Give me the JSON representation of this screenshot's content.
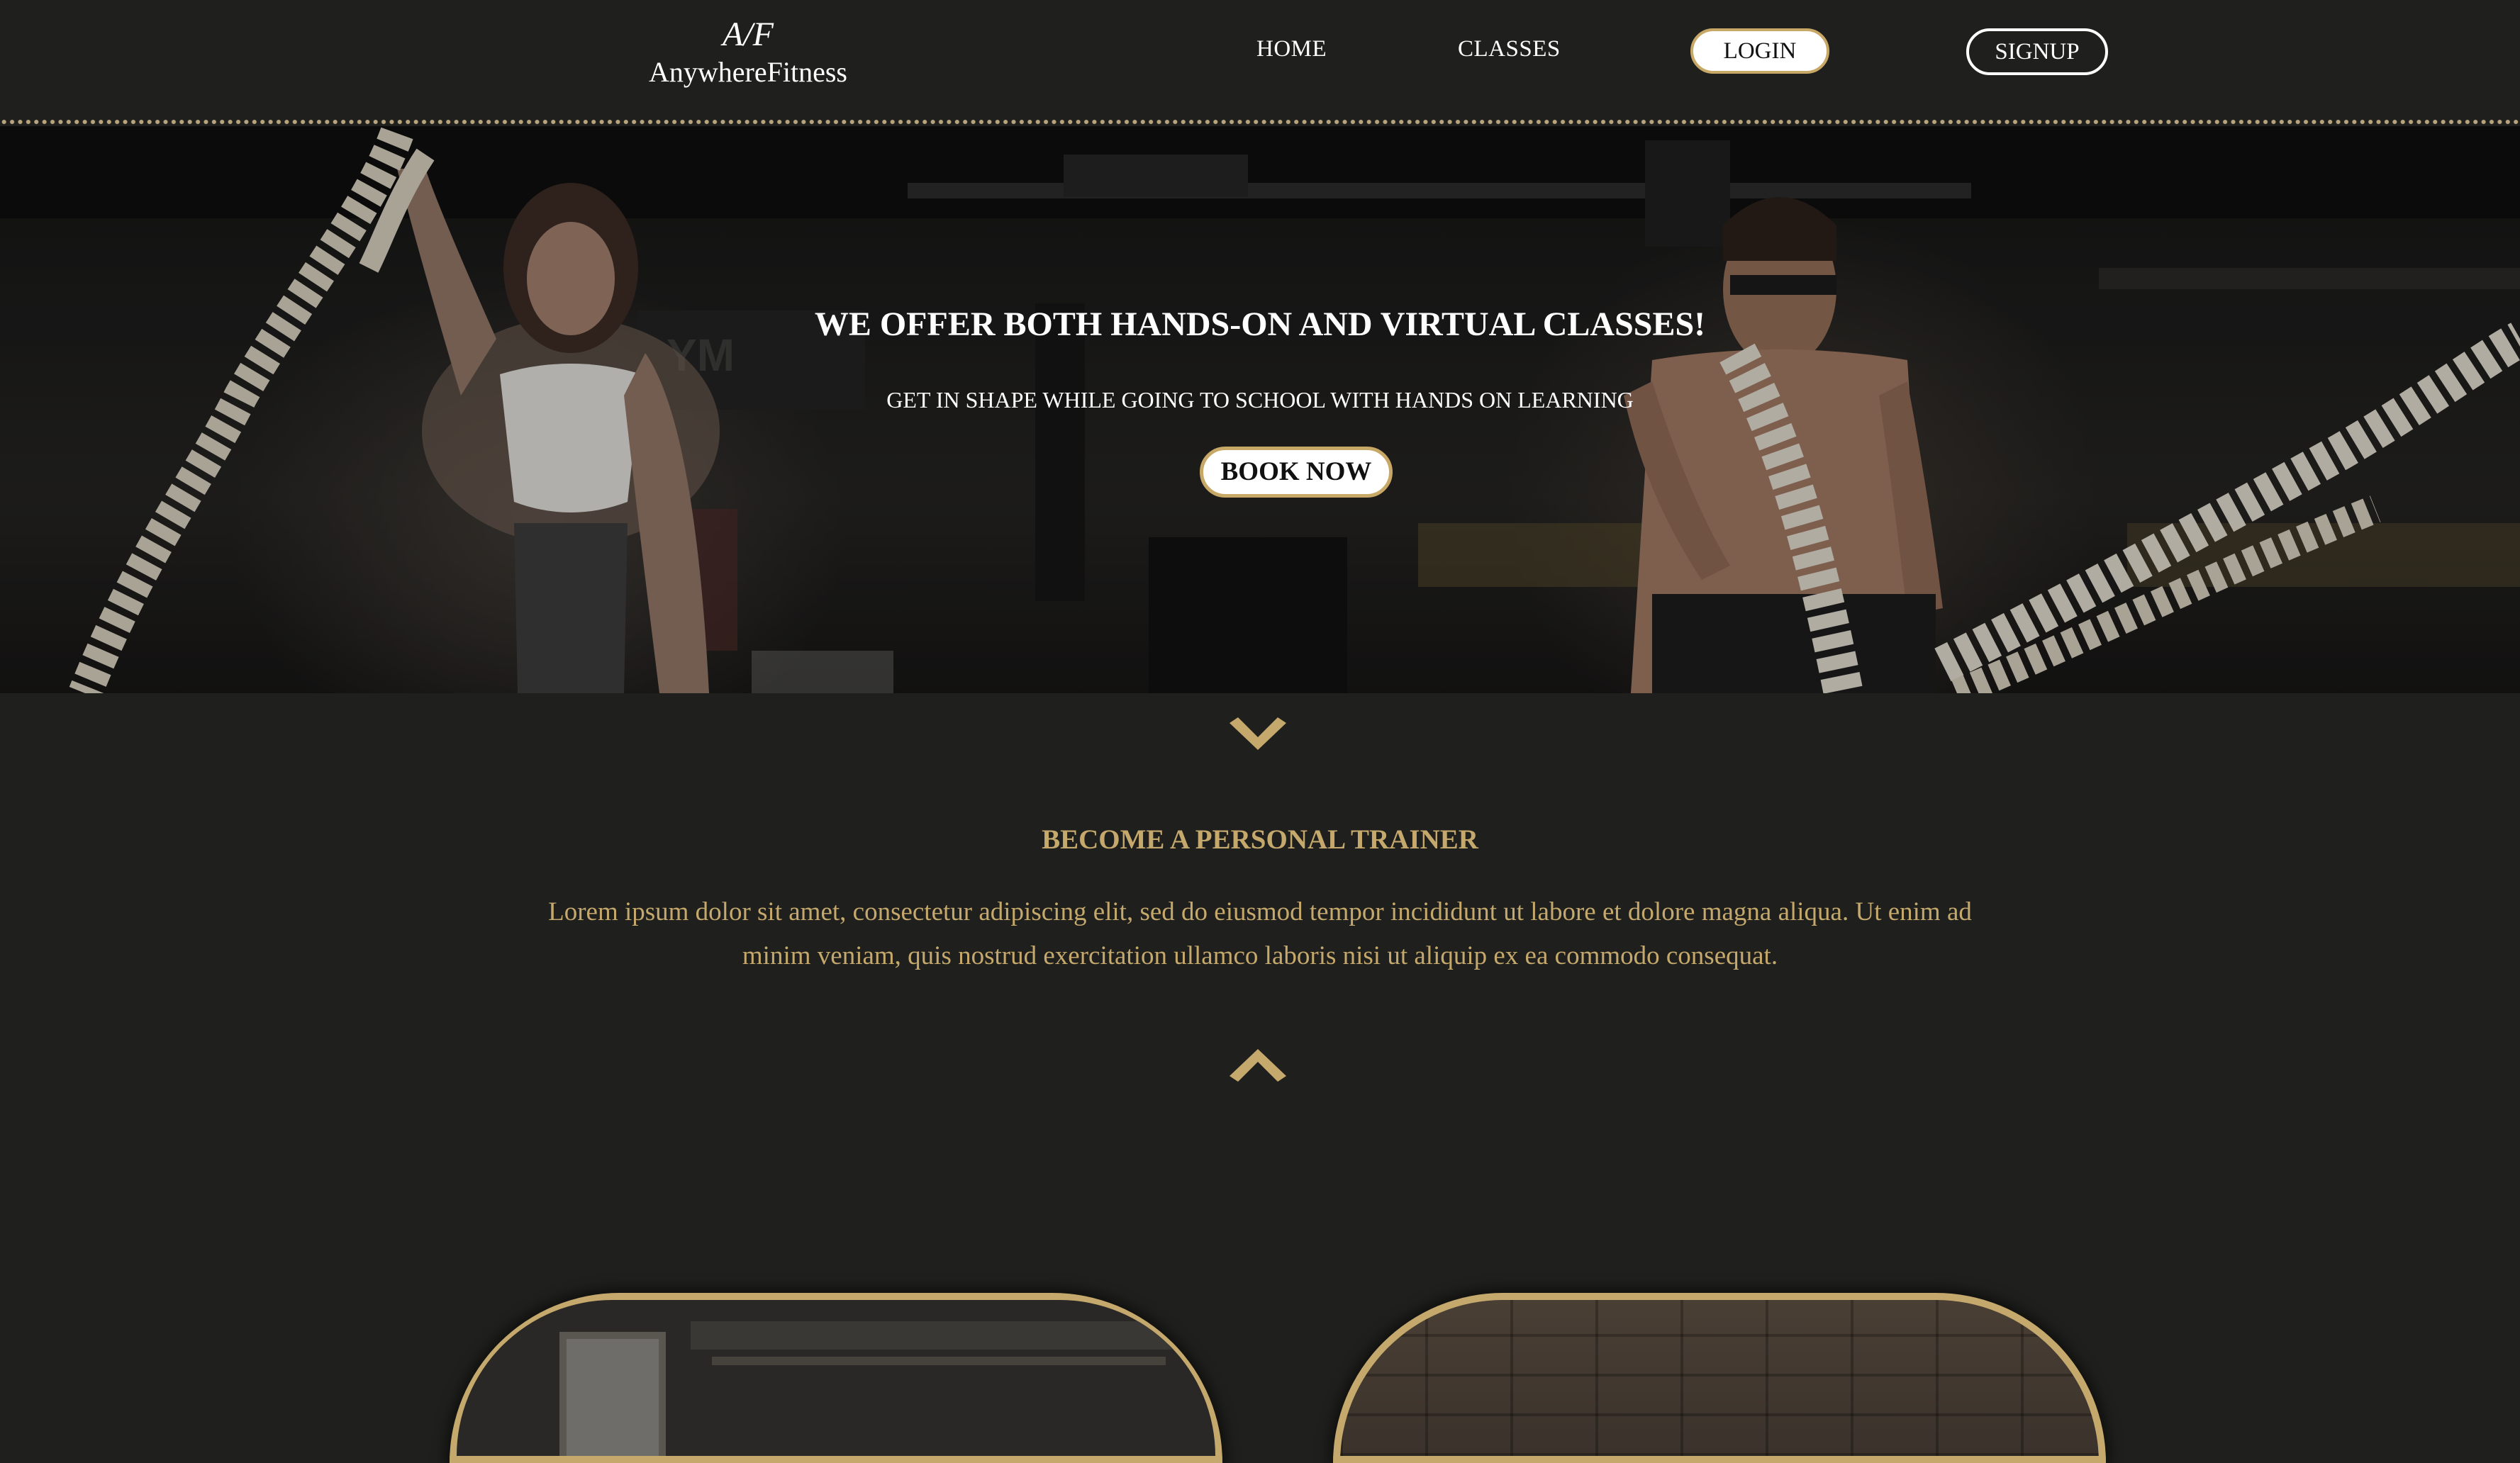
{
  "header": {
    "logo_mark": "A/F",
    "logo_text": "AnywhereFitness",
    "nav": {
      "home": "HOME",
      "classes": "CLASSES",
      "login": "LOGIN",
      "signup": "SIGNUP"
    }
  },
  "hero": {
    "title": "WE OFFER BOTH HANDS-ON AND VIRTUAL CLASSES!",
    "subtitle": "GET IN SHAPE WHILE GOING TO SCHOOL WITH HANDS ON LEARNING",
    "cta": "BOOK NOW"
  },
  "info": {
    "heading": "BECOME A PERSONAL TRAINER",
    "text": "Lorem ipsum dolor sit amet, consectetur adipiscing elit, sed do eiusmod tempor incididunt ut labore et dolore magna aliqua. Ut enim ad minim veniam, quis nostrud exercitation ullamco laboris nisi ut aliquip ex ea commodo consequat."
  },
  "colors": {
    "background": "#1f1f1d",
    "accent_gold": "#c4a86c",
    "text_light": "#ffffff"
  },
  "icons": {
    "expand": "chevron-down-icon",
    "collapse": "chevron-up-icon"
  }
}
